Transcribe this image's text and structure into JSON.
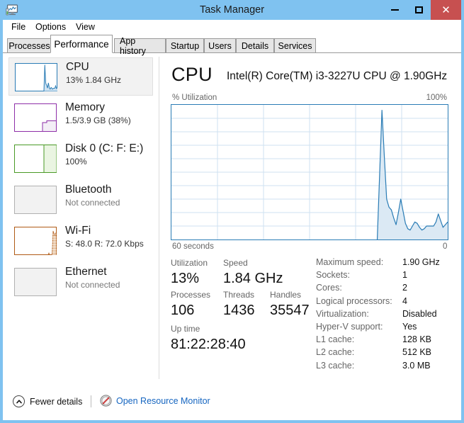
{
  "window": {
    "title": "Task Manager",
    "app_icon": "task-manager-icon",
    "accent_color": "#7fc2f0",
    "close_color": "#c75050",
    "controls": {
      "minimize": "Minimize",
      "maximize": "Maximize",
      "close": "Close"
    }
  },
  "menu": {
    "items": [
      "File",
      "Options",
      "View"
    ]
  },
  "tabs": {
    "selected": "Performance",
    "items": [
      "Processes",
      "Performance",
      "App history",
      "Startup",
      "Users",
      "Details",
      "Services"
    ]
  },
  "sidebar": {
    "items": [
      {
        "name": "CPU",
        "title": "CPU",
        "subtitle": "13%  1.84 GHz",
        "selected": true,
        "color": "#2a7cb5",
        "graph": "cpu-thumbnail"
      },
      {
        "name": "Memory",
        "title": "Memory",
        "subtitle": "1.5/3.9 GB (38%)",
        "selected": false,
        "color": "#8e2fa8",
        "graph": "memory-thumbnail"
      },
      {
        "name": "Disk 0",
        "title": "Disk 0 (C: F: E:)",
        "subtitle": "100%",
        "selected": false,
        "color": "#4a9a26",
        "graph": "disk-thumbnail"
      },
      {
        "name": "Bluetooth",
        "title": "Bluetooth",
        "subtitle": "Not connected",
        "selected": false,
        "color": "#b0b0b0",
        "graph": "empty-thumbnail"
      },
      {
        "name": "Wi-Fi",
        "title": "Wi-Fi",
        "subtitle": "S: 48.0 R: 72.0 Kbps",
        "selected": false,
        "color": "#b05a15",
        "graph": "wifi-thumbnail"
      },
      {
        "name": "Ethernet",
        "title": "Ethernet",
        "subtitle": "Not connected",
        "selected": false,
        "color": "#b0b0b0",
        "graph": "empty-thumbnail"
      }
    ]
  },
  "main": {
    "heading": "CPU",
    "model": "Intel(R) Core(TM) i3-3227U CPU @ 1.90GHz",
    "axis_y_label": "% Utilization",
    "axis_y_max": "100%",
    "axis_x_left": "60 seconds",
    "axis_x_right": "0"
  },
  "chart_data": {
    "type": "area",
    "title": "% Utilization",
    "xlabel": "60 seconds",
    "ylabel": "% Utilization",
    "ylim": [
      0,
      100
    ],
    "xlim": [
      60,
      0
    ],
    "grid": true,
    "grid_columns": 6,
    "grid_rows": 10,
    "line_color": "#2a7cb5",
    "fill_color": "#dbe9f4",
    "legend": "none",
    "note": "History begins ~15 seconds ago; no data for the older 45 seconds",
    "x": [
      15.0,
      14.5,
      14.0,
      13.5,
      13.0,
      12.5,
      12.0,
      11.5,
      11.0,
      10.5,
      10.0,
      9.5,
      9.0,
      8.5,
      8.0,
      7.5,
      7.0,
      6.5,
      6.0,
      5.5,
      5.0,
      4.5,
      4.0,
      3.5,
      3.0,
      2.5,
      2.0,
      1.5,
      1.0,
      0.5,
      0.0
    ],
    "values": [
      0,
      48,
      96,
      62,
      30,
      24,
      22,
      16,
      11,
      20,
      30,
      21,
      12,
      8,
      7,
      10,
      13,
      12,
      9,
      7,
      8,
      10,
      10,
      10,
      10,
      13,
      19,
      14,
      9,
      11,
      13
    ]
  },
  "stats": {
    "utilization": {
      "label": "Utilization",
      "value": "13%"
    },
    "speed": {
      "label": "Speed",
      "value": "1.84 GHz"
    },
    "processes": {
      "label": "Processes",
      "value": "106"
    },
    "threads": {
      "label": "Threads",
      "value": "1436"
    },
    "handles": {
      "label": "Handles",
      "value": "35547"
    },
    "uptime": {
      "label": "Up time",
      "value": "81:22:28:40"
    }
  },
  "specs": [
    {
      "key": "Maximum speed:",
      "value": "1.90 GHz"
    },
    {
      "key": "Sockets:",
      "value": "1"
    },
    {
      "key": "Cores:",
      "value": "2"
    },
    {
      "key": "Logical processors:",
      "value": "4"
    },
    {
      "key": "Virtualization:",
      "value": "Disabled"
    },
    {
      "key": "Hyper-V support:",
      "value": "Yes"
    },
    {
      "key": "L1 cache:",
      "value": "128 KB"
    },
    {
      "key": "L2 cache:",
      "value": "512 KB"
    },
    {
      "key": "L3 cache:",
      "value": "3.0 MB"
    }
  ],
  "footer": {
    "fewer_details": "Fewer details",
    "fewer_details_icon": "chevron-up-icon",
    "resource_monitor": "Open Resource Monitor",
    "resource_monitor_icon": "resource-monitor-icon",
    "link_color": "#1565c0"
  }
}
